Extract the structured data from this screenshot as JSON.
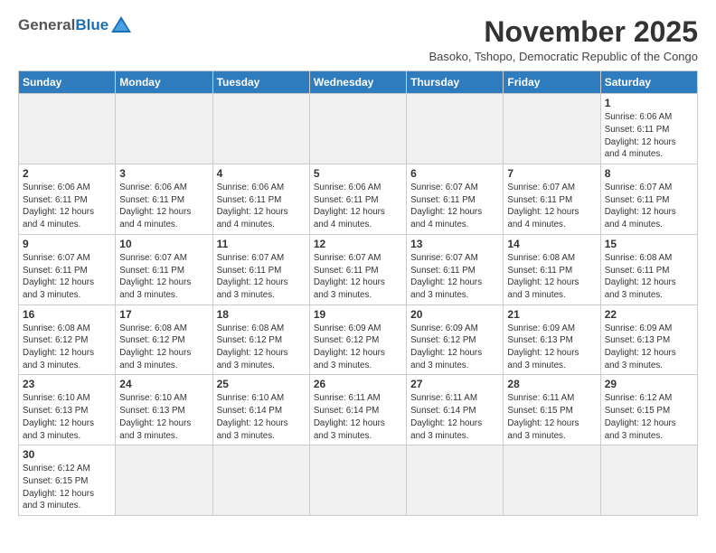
{
  "logo": {
    "general": "General",
    "blue": "Blue"
  },
  "title": "November 2025",
  "subtitle": "Basoko, Tshopo, Democratic Republic of the Congo",
  "days_of_week": [
    "Sunday",
    "Monday",
    "Tuesday",
    "Wednesday",
    "Thursday",
    "Friday",
    "Saturday"
  ],
  "weeks": [
    [
      {
        "day": "",
        "empty": true
      },
      {
        "day": "",
        "empty": true
      },
      {
        "day": "",
        "empty": true
      },
      {
        "day": "",
        "empty": true
      },
      {
        "day": "",
        "empty": true
      },
      {
        "day": "",
        "empty": true
      },
      {
        "day": "1",
        "info": "Sunrise: 6:06 AM\nSunset: 6:11 PM\nDaylight: 12 hours\nand 4 minutes."
      }
    ],
    [
      {
        "day": "2",
        "info": "Sunrise: 6:06 AM\nSunset: 6:11 PM\nDaylight: 12 hours\nand 4 minutes."
      },
      {
        "day": "3",
        "info": "Sunrise: 6:06 AM\nSunset: 6:11 PM\nDaylight: 12 hours\nand 4 minutes."
      },
      {
        "day": "4",
        "info": "Sunrise: 6:06 AM\nSunset: 6:11 PM\nDaylight: 12 hours\nand 4 minutes."
      },
      {
        "day": "5",
        "info": "Sunrise: 6:06 AM\nSunset: 6:11 PM\nDaylight: 12 hours\nand 4 minutes."
      },
      {
        "day": "6",
        "info": "Sunrise: 6:07 AM\nSunset: 6:11 PM\nDaylight: 12 hours\nand 4 minutes."
      },
      {
        "day": "7",
        "info": "Sunrise: 6:07 AM\nSunset: 6:11 PM\nDaylight: 12 hours\nand 4 minutes."
      },
      {
        "day": "8",
        "info": "Sunrise: 6:07 AM\nSunset: 6:11 PM\nDaylight: 12 hours\nand 4 minutes."
      }
    ],
    [
      {
        "day": "9",
        "info": "Sunrise: 6:07 AM\nSunset: 6:11 PM\nDaylight: 12 hours\nand 3 minutes."
      },
      {
        "day": "10",
        "info": "Sunrise: 6:07 AM\nSunset: 6:11 PM\nDaylight: 12 hours\nand 3 minutes."
      },
      {
        "day": "11",
        "info": "Sunrise: 6:07 AM\nSunset: 6:11 PM\nDaylight: 12 hours\nand 3 minutes."
      },
      {
        "day": "12",
        "info": "Sunrise: 6:07 AM\nSunset: 6:11 PM\nDaylight: 12 hours\nand 3 minutes."
      },
      {
        "day": "13",
        "info": "Sunrise: 6:07 AM\nSunset: 6:11 PM\nDaylight: 12 hours\nand 3 minutes."
      },
      {
        "day": "14",
        "info": "Sunrise: 6:08 AM\nSunset: 6:11 PM\nDaylight: 12 hours\nand 3 minutes."
      },
      {
        "day": "15",
        "info": "Sunrise: 6:08 AM\nSunset: 6:11 PM\nDaylight: 12 hours\nand 3 minutes."
      }
    ],
    [
      {
        "day": "16",
        "info": "Sunrise: 6:08 AM\nSunset: 6:12 PM\nDaylight: 12 hours\nand 3 minutes."
      },
      {
        "day": "17",
        "info": "Sunrise: 6:08 AM\nSunset: 6:12 PM\nDaylight: 12 hours\nand 3 minutes."
      },
      {
        "day": "18",
        "info": "Sunrise: 6:08 AM\nSunset: 6:12 PM\nDaylight: 12 hours\nand 3 minutes."
      },
      {
        "day": "19",
        "info": "Sunrise: 6:09 AM\nSunset: 6:12 PM\nDaylight: 12 hours\nand 3 minutes."
      },
      {
        "day": "20",
        "info": "Sunrise: 6:09 AM\nSunset: 6:12 PM\nDaylight: 12 hours\nand 3 minutes."
      },
      {
        "day": "21",
        "info": "Sunrise: 6:09 AM\nSunset: 6:13 PM\nDaylight: 12 hours\nand 3 minutes."
      },
      {
        "day": "22",
        "info": "Sunrise: 6:09 AM\nSunset: 6:13 PM\nDaylight: 12 hours\nand 3 minutes."
      }
    ],
    [
      {
        "day": "23",
        "info": "Sunrise: 6:10 AM\nSunset: 6:13 PM\nDaylight: 12 hours\nand 3 minutes."
      },
      {
        "day": "24",
        "info": "Sunrise: 6:10 AM\nSunset: 6:13 PM\nDaylight: 12 hours\nand 3 minutes."
      },
      {
        "day": "25",
        "info": "Sunrise: 6:10 AM\nSunset: 6:14 PM\nDaylight: 12 hours\nand 3 minutes."
      },
      {
        "day": "26",
        "info": "Sunrise: 6:11 AM\nSunset: 6:14 PM\nDaylight: 12 hours\nand 3 minutes."
      },
      {
        "day": "27",
        "info": "Sunrise: 6:11 AM\nSunset: 6:14 PM\nDaylight: 12 hours\nand 3 minutes."
      },
      {
        "day": "28",
        "info": "Sunrise: 6:11 AM\nSunset: 6:15 PM\nDaylight: 12 hours\nand 3 minutes."
      },
      {
        "day": "29",
        "info": "Sunrise: 6:12 AM\nSunset: 6:15 PM\nDaylight: 12 hours\nand 3 minutes."
      }
    ],
    [
      {
        "day": "30",
        "info": "Sunrise: 6:12 AM\nSunset: 6:15 PM\nDaylight: 12 hours\nand 3 minutes."
      },
      {
        "day": "",
        "empty": true
      },
      {
        "day": "",
        "empty": true
      },
      {
        "day": "",
        "empty": true
      },
      {
        "day": "",
        "empty": true
      },
      {
        "day": "",
        "empty": true
      },
      {
        "day": "",
        "empty": true
      }
    ]
  ]
}
